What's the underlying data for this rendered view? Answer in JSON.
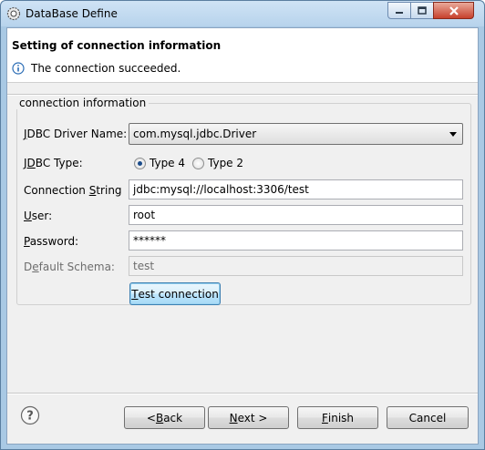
{
  "window": {
    "title": "DataBase Define"
  },
  "header": {
    "title": "Setting of connection information",
    "message": "The connection succeeded."
  },
  "group": {
    "legend": "connection information",
    "driver": {
      "label_pre": "",
      "label_u": "J",
      "label_post": "DBC Driver Name:",
      "value": "com.mysql.jdbc.Driver"
    },
    "type": {
      "label_pre": "J",
      "label_u": "D",
      "label_post": "BC Type:",
      "options": [
        "Type 4",
        "Type 2"
      ],
      "selected": "Type 4"
    },
    "connection": {
      "label_pre": "Connection ",
      "label_u": "S",
      "label_post": "tring",
      "value": "jdbc:mysql://localhost:3306/test"
    },
    "user": {
      "label_pre": "",
      "label_u": "U",
      "label_post": "ser:",
      "value": "root"
    },
    "password": {
      "label_pre": "",
      "label_u": "P",
      "label_post": "assword:",
      "value": "******"
    },
    "schema": {
      "label_pre": "D",
      "label_u": "e",
      "label_post": "fault Schema:",
      "value": "test"
    },
    "test_button": {
      "pre": "",
      "u": "T",
      "post": "est connection"
    }
  },
  "footer": {
    "back": {
      "pre": "< ",
      "u": "B",
      "post": "ack"
    },
    "next": {
      "pre": "",
      "u": "N",
      "post": "ext >"
    },
    "finish": {
      "pre": "",
      "u": "F",
      "post": "inish"
    },
    "cancel": {
      "label": "Cancel"
    }
  }
}
